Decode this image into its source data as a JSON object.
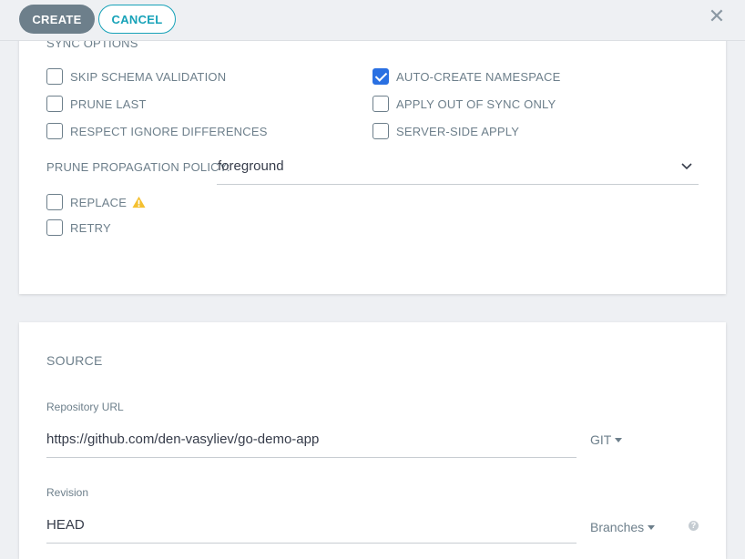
{
  "toolbar": {
    "create_label": "CREATE",
    "cancel_label": "CANCEL",
    "close_glyph": "✕"
  },
  "sync": {
    "section_title": "SYNC OPTIONS",
    "options": [
      {
        "label": "SKIP SCHEMA VALIDATION",
        "checked": false
      },
      {
        "label": "AUTO-CREATE NAMESPACE",
        "checked": true
      },
      {
        "label": "PRUNE LAST",
        "checked": false
      },
      {
        "label": "APPLY OUT OF SYNC ONLY",
        "checked": false
      },
      {
        "label": "RESPECT IGNORE DIFFERENCES",
        "checked": false
      },
      {
        "label": "SERVER-SIDE APPLY",
        "checked": false
      }
    ],
    "prune_policy_label": "PRUNE PROPAGATION POLICY:",
    "prune_policy_value": "foreground",
    "replace_label": "REPLACE",
    "replace_checked": false,
    "retry_label": "RETRY",
    "retry_checked": false
  },
  "source": {
    "section_title": "SOURCE",
    "repo_label": "Repository URL",
    "repo_value": "https://github.com/den-vasyliev/go-demo-app",
    "repo_type": "GIT",
    "revision_label": "Revision",
    "revision_value": "HEAD",
    "revision_type": "Branches",
    "help_glyph": "?"
  },
  "icons": {
    "close": "close-icon",
    "warning": "warning-icon",
    "chevron": "chevron-down-icon",
    "help": "help-icon"
  },
  "colors": {
    "accent": "#2a70e2",
    "create_button": "#6d7f8b",
    "cancel_border": "#17a2b8",
    "warning": "#f4c030"
  }
}
